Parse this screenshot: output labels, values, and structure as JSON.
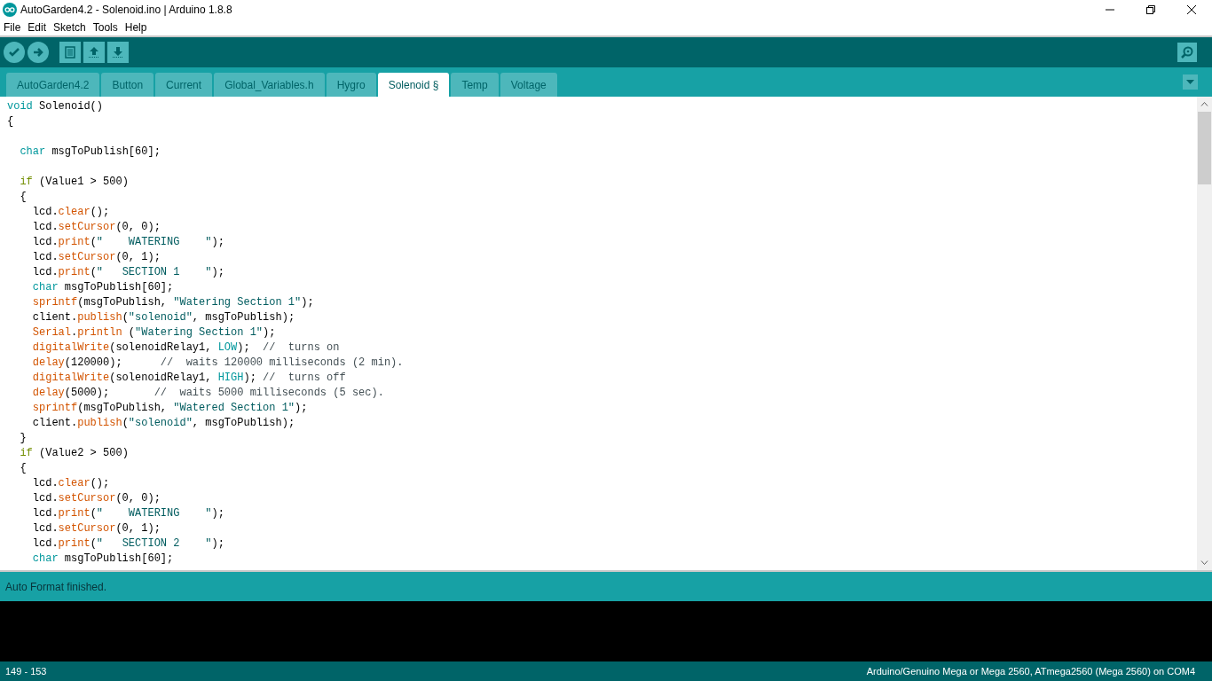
{
  "window": {
    "title": "AutoGarden4.2 - Solenoid.ino | Arduino 1.8.8"
  },
  "menu": [
    "File",
    "Edit",
    "Sketch",
    "Tools",
    "Help"
  ],
  "tabs": [
    {
      "label": "AutoGarden4.2",
      "selected": false
    },
    {
      "label": "Button",
      "selected": false
    },
    {
      "label": "Current",
      "selected": false
    },
    {
      "label": "Global_Variables.h",
      "selected": false
    },
    {
      "label": "Hygro",
      "selected": false
    },
    {
      "label": "Solenoid §",
      "selected": true
    },
    {
      "label": "Temp",
      "selected": false
    },
    {
      "label": "Voltage",
      "selected": false
    }
  ],
  "editor": {
    "blocks": [
      {
        "lines": [
          {
            "tokens": [
              {
                "kind": "type",
                "text": "void"
              },
              {
                "kind": "plain",
                "text": " Solenoid()"
              }
            ]
          },
          {
            "tokens": [
              {
                "kind": "plain",
                "text": "{"
              }
            ]
          }
        ]
      },
      {
        "lines": [
          {
            "tokens": [
              {
                "kind": "type",
                "text": "  char"
              },
              {
                "kind": "plain",
                "text": " msgToPublish[60];"
              }
            ]
          }
        ]
      },
      {
        "lines": [
          {
            "tokens": [
              {
                "kind": "control",
                "text": "  if"
              },
              {
                "kind": "plain",
                "text": " (Value1 > 500)"
              }
            ]
          },
          {
            "tokens": [
              {
                "kind": "plain",
                "text": "  {"
              }
            ]
          },
          {
            "tokens": [
              {
                "kind": "plain",
                "text": "    lcd."
              },
              {
                "kind": "function",
                "text": "clear"
              },
              {
                "kind": "plain",
                "text": "();"
              }
            ]
          },
          {
            "tokens": [
              {
                "kind": "plain",
                "text": "    lcd."
              },
              {
                "kind": "function",
                "text": "setCursor"
              },
              {
                "kind": "plain",
                "text": "(0, 0);"
              }
            ]
          },
          {
            "tokens": [
              {
                "kind": "plain",
                "text": "    lcd."
              },
              {
                "kind": "function",
                "text": "print"
              },
              {
                "kind": "plain",
                "text": "("
              },
              {
                "kind": "string",
                "text": "\"    WATERING    \""
              },
              {
                "kind": "plain",
                "text": ");"
              }
            ]
          },
          {
            "tokens": [
              {
                "kind": "plain",
                "text": "    lcd."
              },
              {
                "kind": "function",
                "text": "setCursor"
              },
              {
                "kind": "plain",
                "text": "(0, 1);"
              }
            ]
          },
          {
            "tokens": [
              {
                "kind": "plain",
                "text": "    lcd."
              },
              {
                "kind": "function",
                "text": "print"
              },
              {
                "kind": "plain",
                "text": "("
              },
              {
                "kind": "string",
                "text": "\"   SECTION 1    \""
              },
              {
                "kind": "plain",
                "text": ");"
              }
            ]
          },
          {
            "tokens": [
              {
                "kind": "type",
                "text": "    char"
              },
              {
                "kind": "plain",
                "text": " msgToPublish[60];"
              }
            ]
          },
          {
            "tokens": [
              {
                "kind": "function",
                "text": "    sprintf"
              },
              {
                "kind": "plain",
                "text": "(msgToPublish, "
              },
              {
                "kind": "string",
                "text": "\"Watering Section 1\""
              },
              {
                "kind": "plain",
                "text": ");"
              }
            ]
          },
          {
            "tokens": [
              {
                "kind": "plain",
                "text": "    client."
              },
              {
                "kind": "function",
                "text": "publish"
              },
              {
                "kind": "plain",
                "text": "("
              },
              {
                "kind": "string",
                "text": "\"solenoid\""
              },
              {
                "kind": "plain",
                "text": ", msgToPublish);"
              }
            ]
          },
          {
            "tokens": [
              {
                "kind": "function",
                "text": "    Serial"
              },
              {
                "kind": "plain",
                "text": "."
              },
              {
                "kind": "function",
                "text": "println"
              },
              {
                "kind": "plain",
                "text": " ("
              },
              {
                "kind": "string",
                "text": "\"Watering Section 1\""
              },
              {
                "kind": "plain",
                "text": ");"
              }
            ]
          },
          {
            "tokens": [
              {
                "kind": "function",
                "text": "    digitalWrite"
              },
              {
                "kind": "plain",
                "text": "(solenoidRelay1, "
              },
              {
                "kind": "constant",
                "text": "LOW"
              },
              {
                "kind": "plain",
                "text": ");  "
              },
              {
                "kind": "comment",
                "text": "//  turns on"
              }
            ]
          },
          {
            "tokens": [
              {
                "kind": "function",
                "text": "    delay"
              },
              {
                "kind": "plain",
                "text": "(120000);      "
              },
              {
                "kind": "comment",
                "text": "//  waits 120000 milliseconds (2 min)."
              }
            ]
          },
          {
            "tokens": [
              {
                "kind": "function",
                "text": "    digitalWrite"
              },
              {
                "kind": "plain",
                "text": "(solenoidRelay1, "
              },
              {
                "kind": "constant",
                "text": "HIGH"
              },
              {
                "kind": "plain",
                "text": "); "
              },
              {
                "kind": "comment",
                "text": "//  turns off"
              }
            ]
          },
          {
            "tokens": [
              {
                "kind": "function",
                "text": "    delay"
              },
              {
                "kind": "plain",
                "text": "(5000);       "
              },
              {
                "kind": "comment",
                "text": "//  waits 5000 milliseconds (5 sec)."
              }
            ]
          },
          {
            "tokens": [
              {
                "kind": "function",
                "text": "    sprintf"
              },
              {
                "kind": "plain",
                "text": "(msgToPublish, "
              },
              {
                "kind": "string",
                "text": "\"Watered Section 1\""
              },
              {
                "kind": "plain",
                "text": ");"
              }
            ]
          },
          {
            "tokens": [
              {
                "kind": "plain",
                "text": "    client."
              },
              {
                "kind": "function",
                "text": "publish"
              },
              {
                "kind": "plain",
                "text": "("
              },
              {
                "kind": "string",
                "text": "\"solenoid\""
              },
              {
                "kind": "plain",
                "text": ", msgToPublish);"
              }
            ]
          },
          {
            "tokens": [
              {
                "kind": "plain",
                "text": "  }"
              }
            ]
          },
          {
            "tokens": [
              {
                "kind": "control",
                "text": "  if"
              },
              {
                "kind": "plain",
                "text": " (Value2 > 500)"
              }
            ]
          },
          {
            "tokens": [
              {
                "kind": "plain",
                "text": "  {"
              }
            ]
          },
          {
            "tokens": [
              {
                "kind": "plain",
                "text": "    lcd."
              },
              {
                "kind": "function",
                "text": "clear"
              },
              {
                "kind": "plain",
                "text": "();"
              }
            ]
          },
          {
            "tokens": [
              {
                "kind": "plain",
                "text": "    lcd."
              },
              {
                "kind": "function",
                "text": "setCursor"
              },
              {
                "kind": "plain",
                "text": "(0, 0);"
              }
            ]
          },
          {
            "tokens": [
              {
                "kind": "plain",
                "text": "    lcd."
              },
              {
                "kind": "function",
                "text": "print"
              },
              {
                "kind": "plain",
                "text": "("
              },
              {
                "kind": "string",
                "text": "\"    WATERING    \""
              },
              {
                "kind": "plain",
                "text": ");"
              }
            ]
          },
          {
            "tokens": [
              {
                "kind": "plain",
                "text": "    lcd."
              },
              {
                "kind": "function",
                "text": "setCursor"
              },
              {
                "kind": "plain",
                "text": "(0, 1);"
              }
            ]
          },
          {
            "tokens": [
              {
                "kind": "plain",
                "text": "    lcd."
              },
              {
                "kind": "function",
                "text": "print"
              },
              {
                "kind": "plain",
                "text": "("
              },
              {
                "kind": "string",
                "text": "\"   SECTION 2    \""
              },
              {
                "kind": "plain",
                "text": ");"
              }
            ]
          },
          {
            "tokens": [
              {
                "kind": "type",
                "text": "    char"
              },
              {
                "kind": "plain",
                "text": " msgToPublish[60];"
              }
            ]
          }
        ]
      }
    ]
  },
  "message": "Auto Format finished.",
  "status_bar": {
    "position": "149 - 153",
    "board": "Arduino/Genuino Mega or Mega 2560, ATmega2560 (Mega 2560) on COM4"
  }
}
